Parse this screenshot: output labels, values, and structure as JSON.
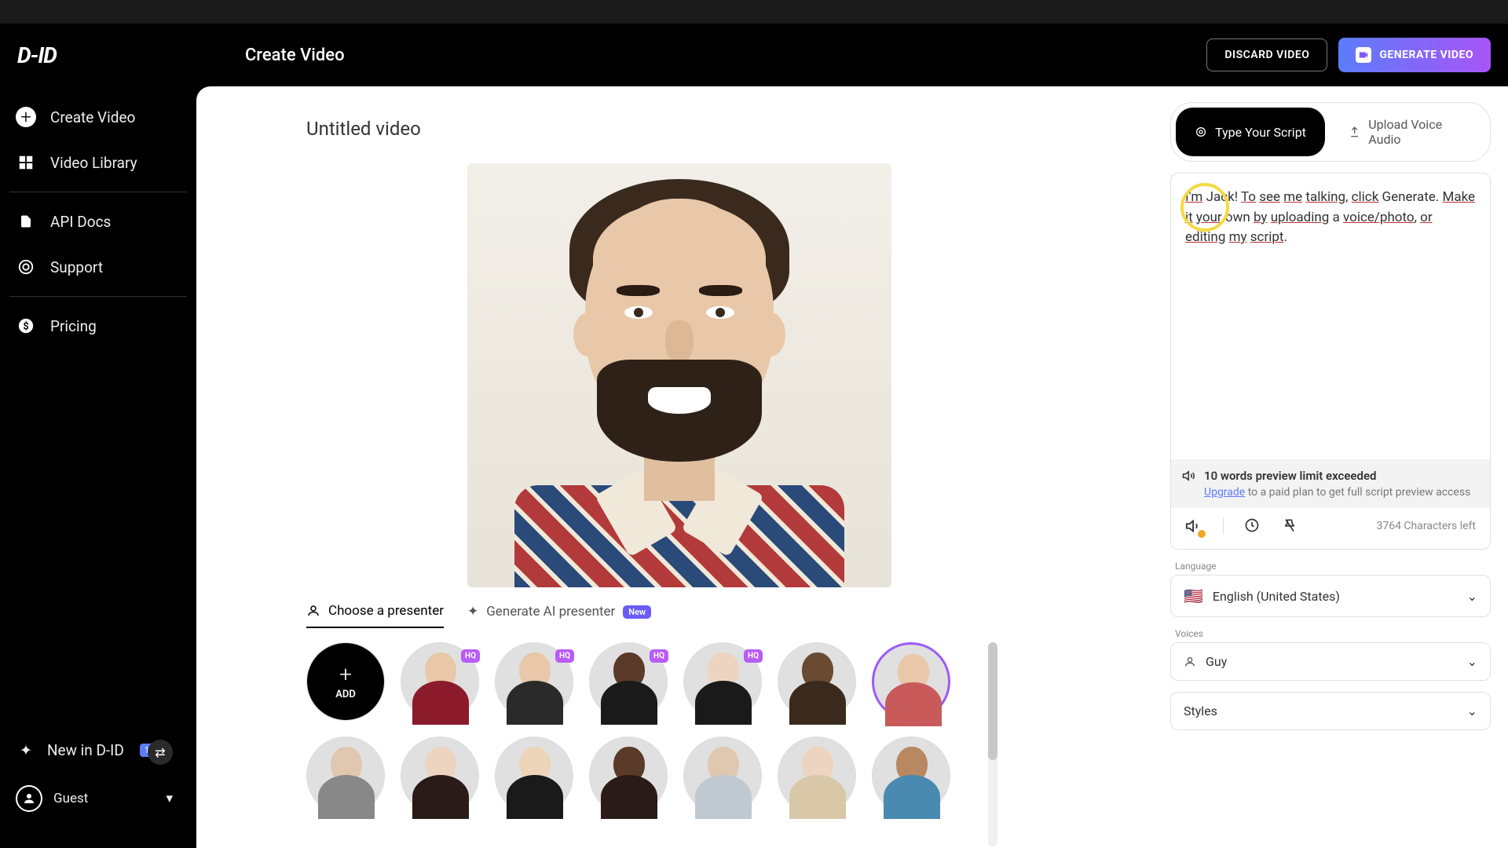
{
  "header": {
    "logo": "D-ID",
    "title": "Create Video",
    "discard": "DISCARD VIDEO",
    "generate": "GENERATE VIDEO"
  },
  "sidebar": {
    "items": [
      {
        "label": "Create Video"
      },
      {
        "label": "Video Library"
      },
      {
        "label": "API Docs"
      },
      {
        "label": "Support"
      },
      {
        "label": "Pricing"
      }
    ],
    "new_in": "New in D-ID",
    "new_badge": "1",
    "guest": "Guest"
  },
  "canvas": {
    "video_title": "Untitled video",
    "tab_choose": "Choose a presenter",
    "tab_ai": "Generate AI presenter",
    "tab_ai_badge": "New",
    "add_label": "ADD"
  },
  "script": {
    "tab_type": "Type Your Script",
    "tab_upload": "Upload Voice Audio",
    "text_parts": {
      "p1": "I'm",
      "p2": "Jack!",
      "p3": "To",
      "p4": "see",
      "p5": "me",
      "p6": "talking",
      "p7": ", ",
      "p8": "click",
      "p9": " Generate. ",
      "p10": "Make",
      "p11": " ",
      "p12": "it",
      "p13": " ",
      "p14": "your",
      "p15": " own ",
      "p16": "by",
      "p17": " ",
      "p18": "uploading",
      "p19": " a ",
      "p20": "voice/photo",
      "p21": ", ",
      "p22": "or",
      "p23": " ",
      "p24": "editing",
      "p25": " ",
      "p26": "my",
      "p27": " ",
      "p28": "script",
      "p29": "."
    },
    "limit_title": "10 words preview limit exceeded",
    "limit_upgrade": "Upgrade",
    "limit_rest": " to a paid plan to get full script preview access",
    "chars_left": "3764 Characters left"
  },
  "dropdowns": {
    "language_label": "Language",
    "language_value": "English (United States)",
    "voices_label": "Voices",
    "voices_value": "Guy",
    "styles_label": "Styles"
  },
  "presenters": {
    "hq": "HQ"
  }
}
